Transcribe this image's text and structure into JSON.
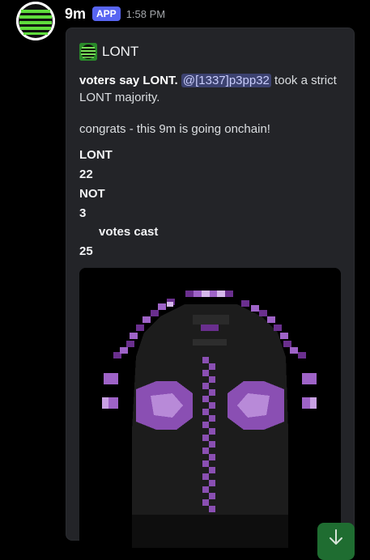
{
  "message": {
    "username": "9m",
    "badge": "APP",
    "timestamp": "1:58 PM"
  },
  "embed": {
    "author": "LONT",
    "desc_bold": "voters say LONT.",
    "mention": "@[1337]p3pp32",
    "desc_rest": " took a strict LONT majority.",
    "congrats": "congrats - this 9m is going onchain!",
    "fields": [
      {
        "label": "LONT",
        "value": "22"
      },
      {
        "label": "NOT",
        "value": "3"
      },
      {
        "label": "votes cast",
        "value": "25"
      }
    ]
  },
  "colors": {
    "accent": "#5865f2",
    "avatar_green": "#5fdc3c",
    "embed_bg": "#232428",
    "pixel_purple": "#8a4fb3",
    "scroll_button": "#1f6d31"
  },
  "icons": {
    "scroll": "arrow-down-icon"
  }
}
